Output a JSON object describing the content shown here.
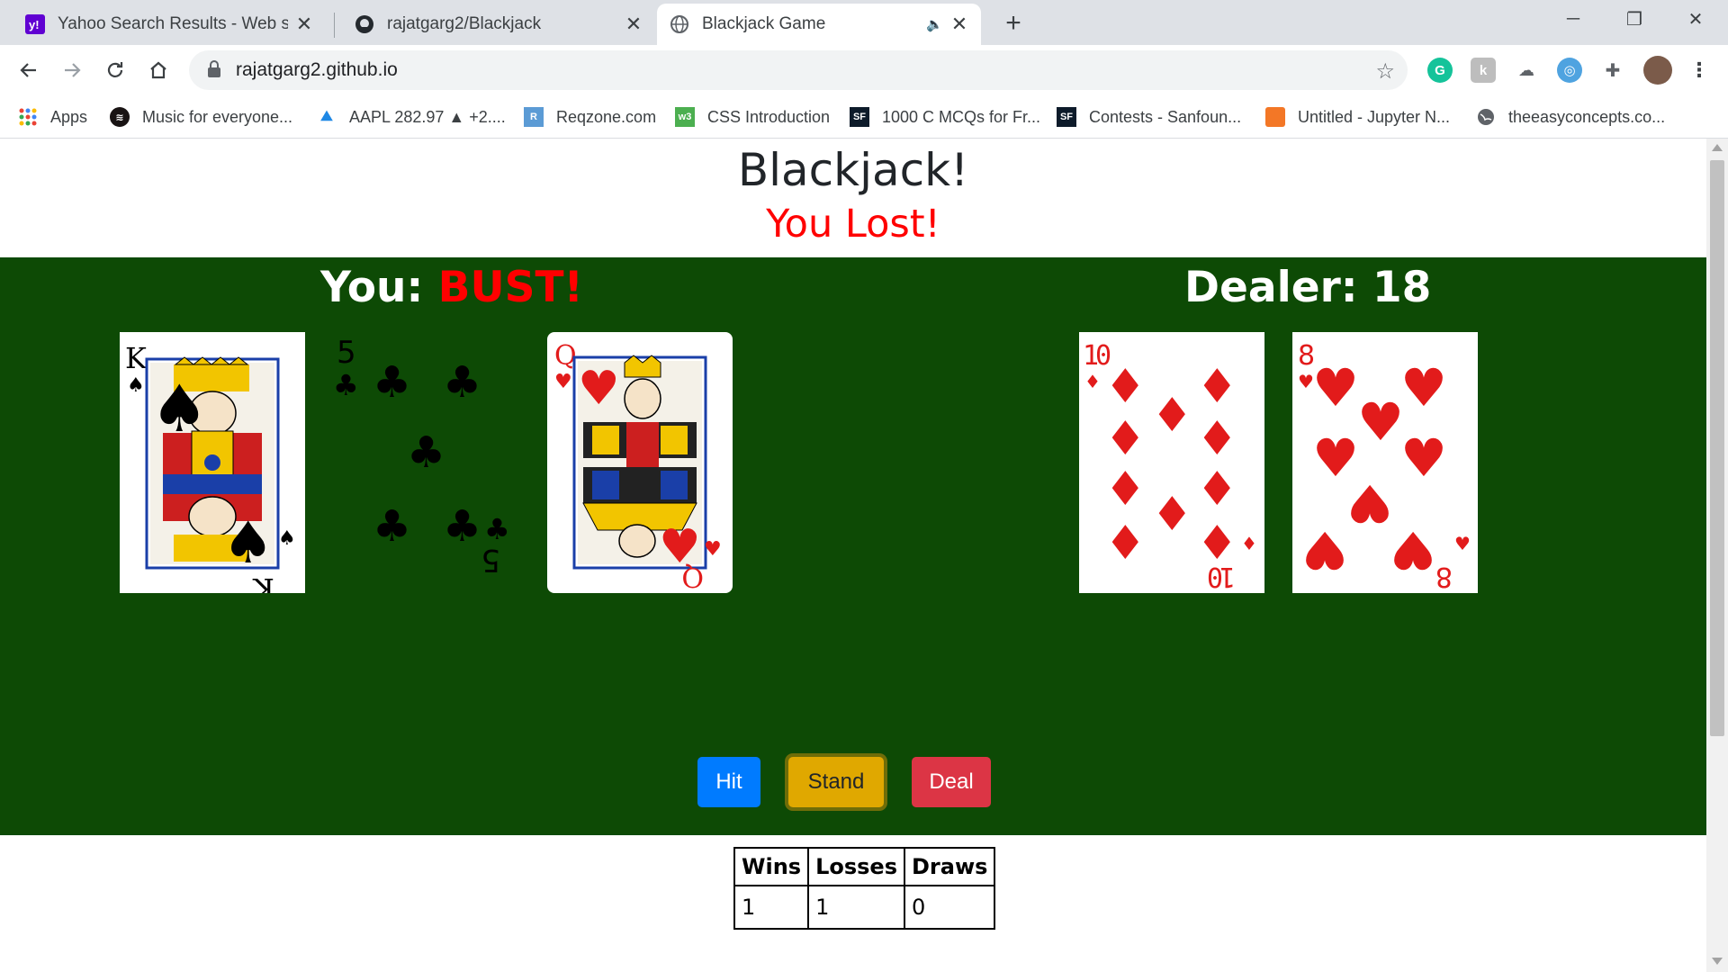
{
  "browser": {
    "tabs": [
      {
        "title": "Yahoo Search Results - Web searc",
        "favicon": "yahoo-icon",
        "active": false
      },
      {
        "title": "rajatgarg2/Blackjack",
        "favicon": "github-icon",
        "active": false
      },
      {
        "title": "Blackjack Game",
        "favicon": "globe-icon",
        "active": true,
        "audio": true
      }
    ],
    "new_tab": "+",
    "url": "rajatgarg2.github.io",
    "bookmarks": [
      {
        "label": "Apps",
        "icon": "apps-grid-icon"
      },
      {
        "label": "Music for everyone...",
        "icon": "spotify-icon"
      },
      {
        "label": "AAPL 282.97 ▲ +2....",
        "icon": "stock-icon"
      },
      {
        "label": "Reqzone.com",
        "icon": "reqzone-icon"
      },
      {
        "label": "CSS Introduction",
        "icon": "w3-icon"
      },
      {
        "label": "1000 C MCQs for Fr...",
        "icon": "sanfoundry-icon"
      },
      {
        "label": "Contests - Sanfoun...",
        "icon": "sanfoundry-icon"
      },
      {
        "label": "Untitled - Jupyter N...",
        "icon": "jupyter-icon"
      },
      {
        "label": "theeasyconcepts.co...",
        "icon": "globe-icon"
      }
    ]
  },
  "game": {
    "title": "Blackjack!",
    "result": "You Lost!",
    "player": {
      "label": "You:",
      "score": "BUST!",
      "cards": [
        "K♠",
        "5♣",
        "Q♥"
      ]
    },
    "dealer": {
      "label": "Dealer:",
      "score": "18",
      "cards": [
        "10♦",
        "8♥"
      ]
    },
    "buttons": {
      "hit": "Hit",
      "stand": "Stand",
      "deal": "Deal"
    },
    "stats": {
      "headers": [
        "Wins",
        "Losses",
        "Draws"
      ],
      "values": [
        "1",
        "1",
        "0"
      ]
    }
  },
  "colors": {
    "felt": "#0d4a05",
    "hit": "#007bff",
    "stand": "#e0a800",
    "deal": "#dc3545",
    "result": "#ff0000"
  }
}
